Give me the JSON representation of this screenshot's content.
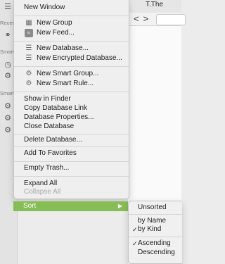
{
  "background": {
    "document_title": "T.The",
    "sidebar_labels": [
      "Recen",
      "Smart",
      "Smart"
    ],
    "nav_back": "<",
    "nav_forward": ">"
  },
  "menu": {
    "new_window": "New Window",
    "new_group": "New Group",
    "new_feed": "New Feed...",
    "new_database": "New Database...",
    "new_encrypted_database": "New Encrypted Database...",
    "new_smart_group": "New Smart Group...",
    "new_smart_rule": "New Smart Rule...",
    "show_in_finder": "Show in Finder",
    "copy_database_link": "Copy Database Link",
    "database_properties": "Database Properties...",
    "close_database": "Close Database",
    "delete_database": "Delete Database...",
    "add_to_favorites": "Add To Favorites",
    "empty_trash": "Empty Trash...",
    "expand_all": "Expand All",
    "collapse_all": "Collapse All",
    "sort": "Sort",
    "sort_arrow": "▶"
  },
  "submenu": {
    "unsorted": "Unsorted",
    "by_name": "by Name",
    "by_kind": "by Kind",
    "ascending": "Ascending",
    "descending": "Descending",
    "checkmark": "✓"
  },
  "colors": {
    "highlight": "#86bd55"
  },
  "icons": {
    "new_group": "folder-icon",
    "new_feed": "rss-feed-icon",
    "new_database": "database-icon",
    "new_encrypted_database": "encrypted-database-icon",
    "new_smart_group": "gear-icon",
    "new_smart_rule": "smart-rule-gears-icon"
  }
}
